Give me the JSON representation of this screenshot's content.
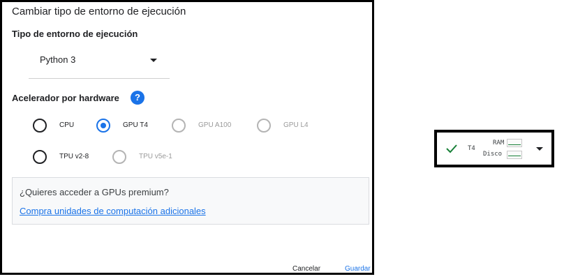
{
  "dialog": {
    "title": "Cambiar tipo de entorno de ejecución",
    "runtime_section_title": "Tipo de entorno de ejecución",
    "runtime_value": "Python 3",
    "accelerator_section_title": "Acelerador por hardware",
    "help_icon_glyph": "?",
    "accelerators": [
      {
        "label": "CPU",
        "state": "enabled"
      },
      {
        "label": "GPU T4",
        "state": "selected"
      },
      {
        "label": "GPU A100",
        "state": "disabled"
      },
      {
        "label": "GPU L4",
        "state": "disabled"
      },
      {
        "label": "TPU v2-8",
        "state": "enabled"
      },
      {
        "label": "TPU v5e-1",
        "state": "disabled"
      }
    ],
    "premium_question": "¿Quieres acceder a GPUs premium?",
    "premium_link": "Compra unidades de computación adicionales",
    "cancel_label": "Cancelar",
    "save_label": "Guardar"
  },
  "resource_widget": {
    "status_icon": "check-icon",
    "gpu_label": "T4",
    "ram_label": "RAM",
    "disk_label": "Disco"
  },
  "colors": {
    "accent": "#1a73e8",
    "status_ok": "#188038"
  }
}
